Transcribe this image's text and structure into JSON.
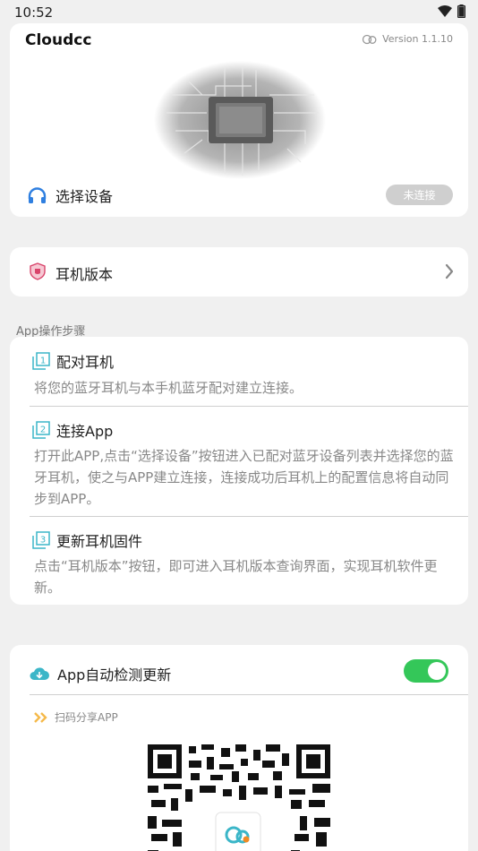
{
  "status_bar": {
    "time": "10:52"
  },
  "header": {
    "app_name": "Cloudcc",
    "version": "Version 1.1.10",
    "device_label": "选择设备",
    "connection_status": "未连接"
  },
  "headset_version": {
    "label": "耳机版本"
  },
  "steps_section": {
    "title": "App操作步骤",
    "steps": [
      {
        "title": "配对耳机",
        "desc": "将您的蓝牙耳机与本手机蓝牙配对建立连接。"
      },
      {
        "title": "连接App",
        "desc": "打开此APP,点击“选择设备”按钮进入已配对蓝牙设备列表并选择您的蓝牙耳机，使之与APP建立连接，连接成功后耳机上的配置信息将自动同步到APP。"
      },
      {
        "title": "更新耳机固件",
        "desc": "点击“耳机版本”按钮，即可进入耳机版本查询界面，实现耳机软件更新。"
      }
    ]
  },
  "update": {
    "auto_check_label": "App自动检测更新",
    "auto_check_enabled": true,
    "share_label": "扫码分享APP"
  },
  "colors": {
    "accent_blue": "#2f7fe0",
    "toggle_on": "#34c759",
    "step_icon": "#3bb6c8",
    "shield": "#d9446b"
  },
  "icons": {
    "headphones": "headphones-icon",
    "shield": "shield-icon",
    "chevron": "chevron-right-icon",
    "cloud_download": "cloud-download-icon",
    "double_chevron": "double-chevron-icon"
  }
}
